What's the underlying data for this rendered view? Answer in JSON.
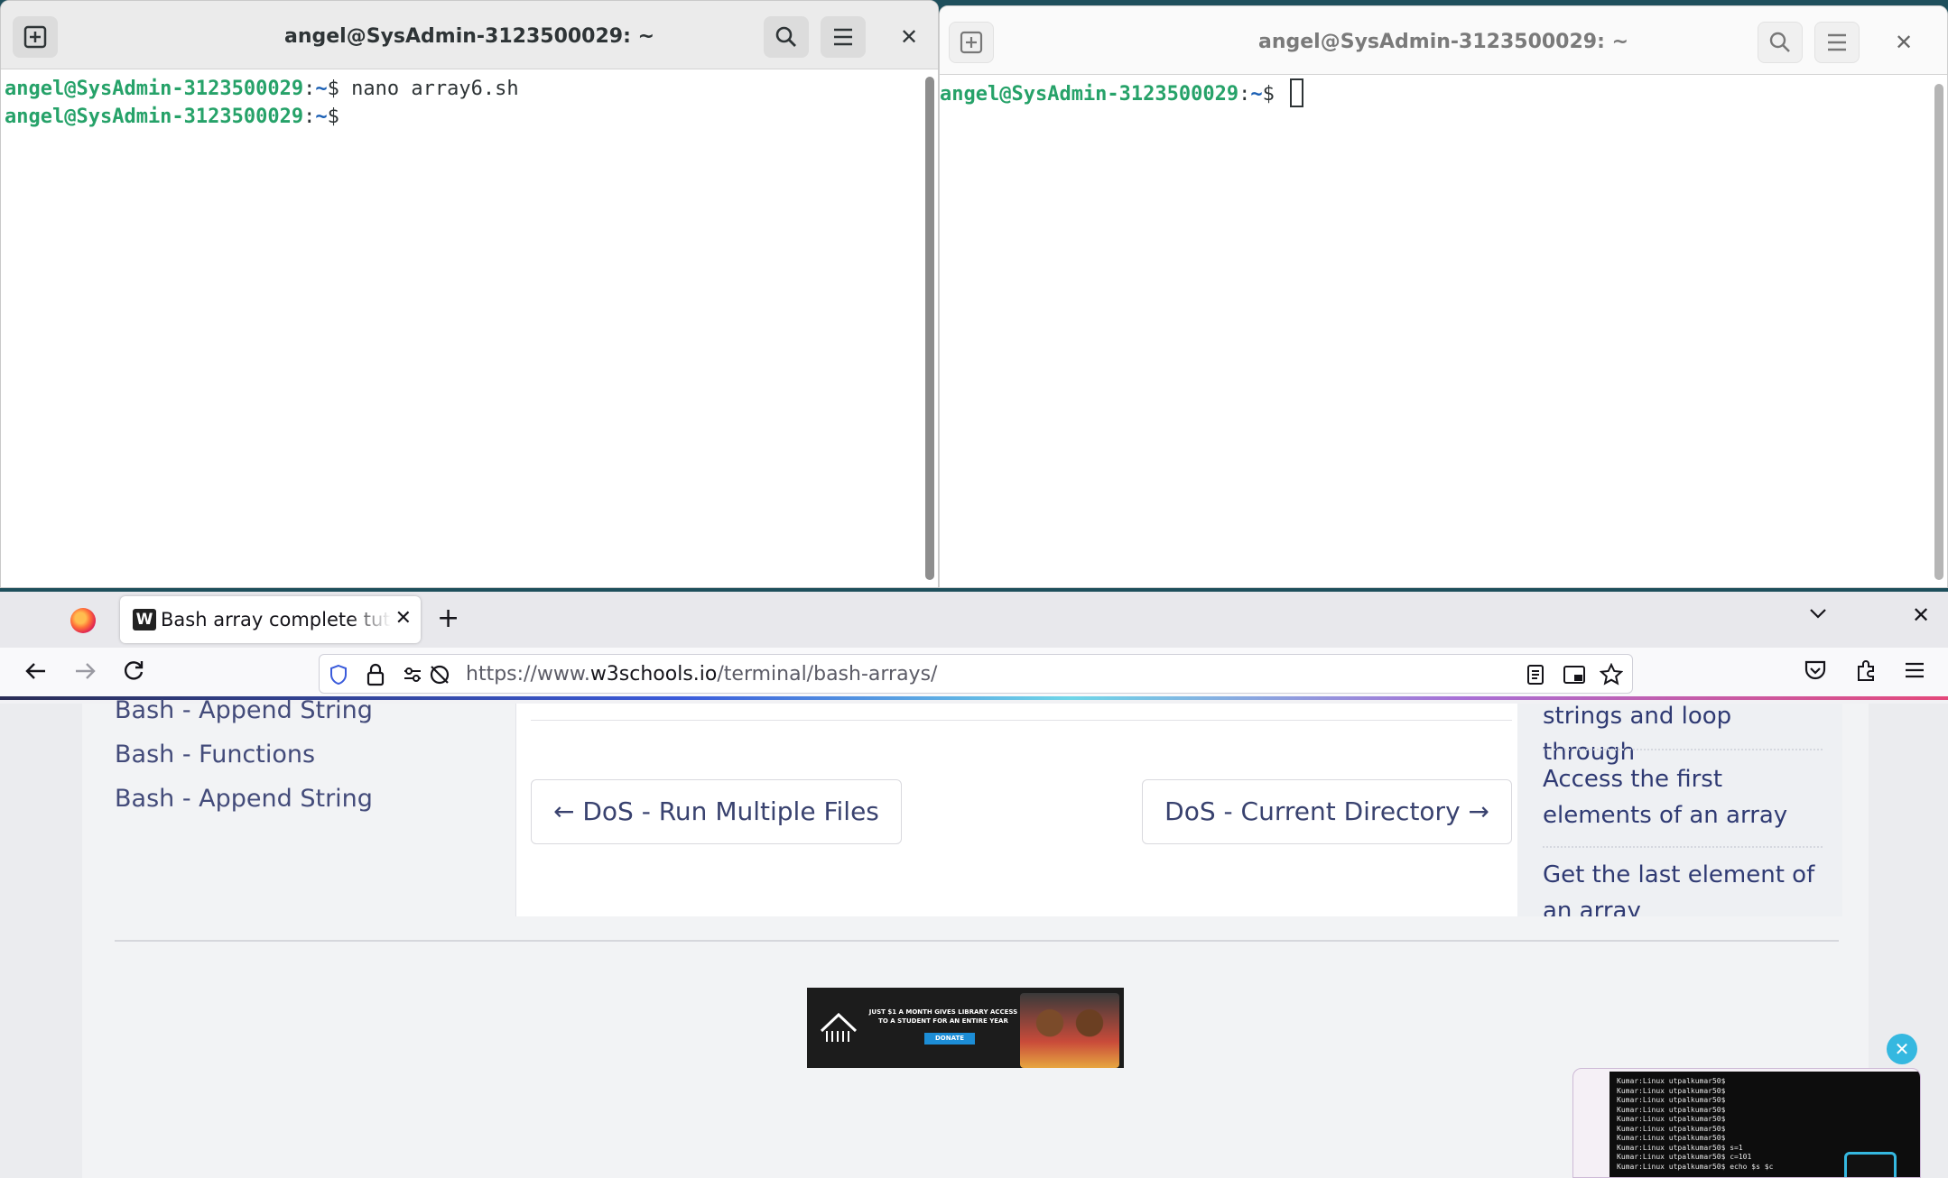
{
  "terminal_left": {
    "title": "angel@SysAdmin-3123500029: ~",
    "lines": [
      {
        "user": "angel@SysAdmin-3123500029",
        "sep": ":",
        "path": "~",
        "prompt": "$ ",
        "command": "nano array6.sh"
      },
      {
        "user": "angel@SysAdmin-3123500029",
        "sep": ":",
        "path": "~",
        "prompt": "$",
        "command": ""
      }
    ]
  },
  "terminal_right": {
    "title": "angel@SysAdmin-3123500029: ~",
    "lines": [
      {
        "user": "angel@SysAdmin-3123500029",
        "sep": ":",
        "path": "~",
        "prompt": "$ ",
        "command": ""
      }
    ]
  },
  "browser": {
    "tab_title": "Bash array complete tutorial",
    "tab_favicon": "W",
    "url_prefix": "https://www.",
    "url_host": "w3schools.io",
    "url_path": "/terminal/bash-arrays/",
    "sidebar_links": [
      "Bash - Append String",
      "Bash - Functions",
      "Bash - Append String"
    ],
    "prev_link": "← DoS - Run Multiple Files",
    "next_link": "DoS - Current Directory →",
    "toc_items": [
      "strings and loop through",
      "Access the first elements of an array",
      "Get the last element of an array"
    ],
    "ad_text": "JUST $1 A MONTH GIVES LIBRARY ACCESS TO A STUDENT FOR AN ENTIRE YEAR",
    "ad_button": "DONATE",
    "ad_brand": "VILLAGE BOOK BUILDERS"
  },
  "pip": {
    "close_glyph": "✕",
    "lines": [
      "Kumar:Linux utpalkumar50$",
      "Kumar:Linux utpalkumar50$",
      "Kumar:Linux utpalkumar50$",
      "Kumar:Linux utpalkumar50$",
      "Kumar:Linux utpalkumar50$",
      "Kumar:Linux utpalkumar50$",
      "Kumar:Linux utpalkumar50$",
      "Kumar:Linux utpalkumar50$ s=1",
      "Kumar:Linux utpalkumar50$ c=101",
      "Kumar:Linux utpalkumar50$ echo $s $c"
    ]
  },
  "colors": {
    "prompt_user": "#26a269",
    "prompt_path": "#1a5fb4",
    "link": "#434b7a",
    "accent_gradient_start": "#2a2d56",
    "accent_gradient_end": "#e4487a"
  },
  "icons": [
    "new-tab-icon",
    "search-icon",
    "hamburger-menu-icon",
    "close-icon",
    "firefox-logo-icon",
    "back-arrow-icon",
    "forward-arrow-icon",
    "reload-icon",
    "shield-icon",
    "lock-icon",
    "permissions-icon",
    "tracking-icon",
    "reader-view-icon",
    "picture-in-picture-icon",
    "bookmark-star-icon",
    "pocket-icon",
    "extensions-icon",
    "menu-icon",
    "list-all-tabs-icon"
  ]
}
